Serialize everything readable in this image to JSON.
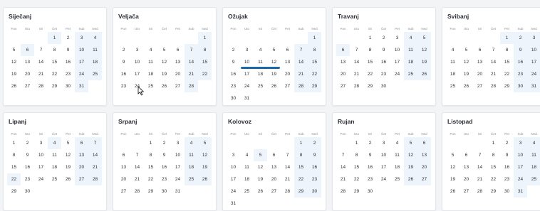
{
  "weekdays": [
    "Pon",
    "Uto",
    "Sri",
    "Čet",
    "Pet",
    "Sub",
    "Ned"
  ],
  "months": [
    {
      "name": "Siječanj",
      "offset": 3,
      "days": 31,
      "holidays": [
        1,
        6
      ]
    },
    {
      "name": "Veljača",
      "offset": 6,
      "days": 28,
      "holidays": []
    },
    {
      "name": "Ožujak",
      "offset": 6,
      "days": 31,
      "holidays": []
    },
    {
      "name": "Travanj",
      "offset": 2,
      "days": 30,
      "holidays": [
        6
      ]
    },
    {
      "name": "Svibanj",
      "offset": 4,
      "days": 31,
      "holidays": [
        1
      ]
    },
    {
      "name": "Lipanj",
      "offset": 0,
      "days": 30,
      "holidays": [
        4,
        22
      ]
    },
    {
      "name": "Srpanj",
      "offset": 2,
      "days": 31,
      "holidays": []
    },
    {
      "name": "Kolovoz",
      "offset": 5,
      "days": 31,
      "holidays": [
        5
      ]
    },
    {
      "name": "Rujan",
      "offset": 1,
      "days": 30,
      "holidays": []
    },
    {
      "name": "Listopad",
      "offset": 3,
      "days": 31,
      "holidays": []
    }
  ],
  "selection": {
    "month_index": 2,
    "from_day": 10,
    "to_day": 12
  },
  "colors": {
    "weekend_highlight": "#eef4fb",
    "selection": "#1769aa"
  }
}
